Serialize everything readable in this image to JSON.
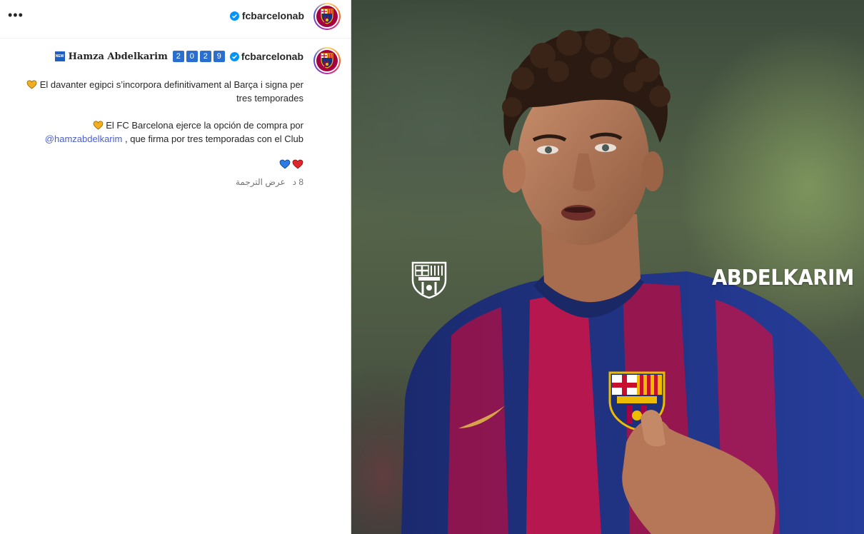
{
  "header": {
    "username": "fcbarcelonab",
    "more_icon": "more-horizontal-icon"
  },
  "post": {
    "author_name": "Hamza Abdelkarim",
    "news_badge": "NEW",
    "digits": [
      "2",
      "0",
      "2",
      "9"
    ],
    "username": "fcbarcelonab",
    "paragraph1": "El davanter egipci s’incorpora definitivament al Barça i signa per tres temporades",
    "paragraph2_before": "El FC Barcelona ejerce la opción de compra por",
    "mention": "@hamzabdelkarim",
    "paragraph2_after": ", que firma por tres temporadas con el Club",
    "hearts": [
      "blue-heart",
      "red-heart"
    ],
    "time": "8 د",
    "translate_label": "عرض الترجمة"
  },
  "image": {
    "overlay_name": "ABDELKARIM"
  },
  "colors": {
    "blaugrana_blue": "#1c2f7a",
    "blaugrana_red": "#a50044",
    "mention": "#4a5ed1",
    "verified": "#0095f6"
  }
}
